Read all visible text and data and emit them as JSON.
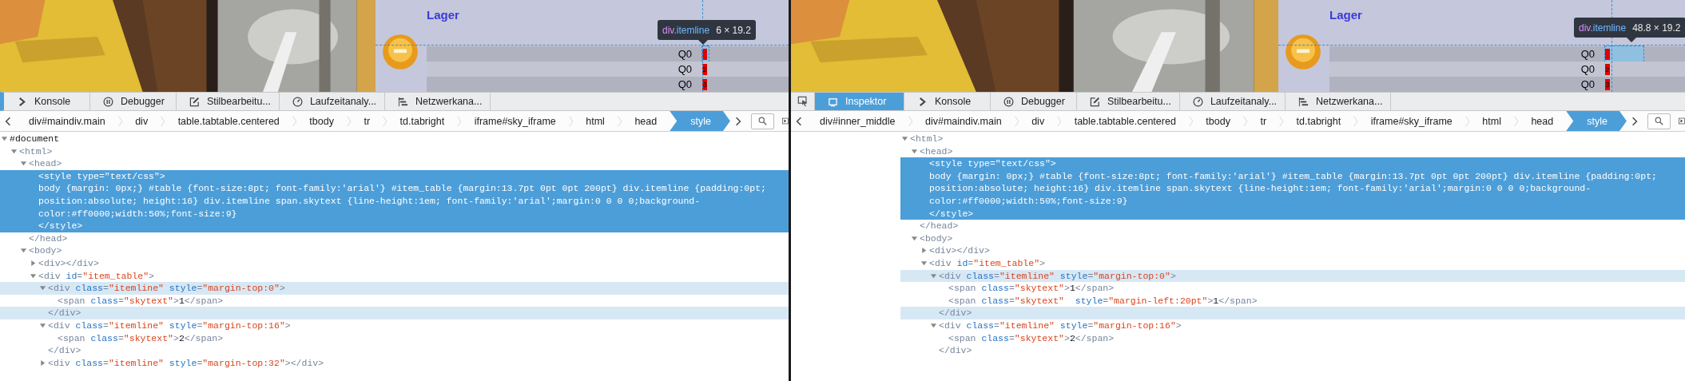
{
  "panels": [
    {
      "preview": {
        "heading": "Lager",
        "tooltip": {
          "tag": "div",
          "cls": ".itemline",
          "size": "6 × 19.2"
        },
        "rows": [
          {
            "cell": "Q0",
            "highlighted": true
          },
          {
            "cell": "Q0",
            "marker": "2",
            "highlighted": false
          },
          {
            "cell": "Q0",
            "marker": "3",
            "highlighted": false
          }
        ]
      },
      "picker": false,
      "tabs": [
        {
          "label": "Konsole",
          "kind": "console",
          "selected": false
        },
        {
          "label": "Debugger",
          "kind": "debugger",
          "selected": false
        },
        {
          "label": "Stilbearbeitu...",
          "kind": "style",
          "selected": false
        },
        {
          "label": "Laufzeitanaly...",
          "kind": "perf",
          "selected": false
        },
        {
          "label": "Netzwerkana...",
          "kind": "network",
          "selected": false
        }
      ],
      "crumbs": [
        {
          "label": "div#maindiv.main",
          "selected": false
        },
        {
          "label": "div",
          "selected": false
        },
        {
          "label": "table.tabtable.centered",
          "selected": false
        },
        {
          "label": "tbody",
          "selected": false
        },
        {
          "label": "tr",
          "selected": false
        },
        {
          "label": "td.tabright",
          "selected": false
        },
        {
          "label": "iframe#sky_iframe",
          "selected": false
        },
        {
          "label": "html",
          "selected": false
        },
        {
          "label": "head",
          "selected": false
        },
        {
          "label": "style",
          "selected": true
        }
      ],
      "nodes": [
        {
          "open": [
            {
              "kind": "text",
              "text": "#document"
            }
          ],
          "expanded": true,
          "selected": false,
          "hovered": false,
          "children": [
            {
              "open": [
                {
                  "kind": "tag",
                  "text": "<html>"
                }
              ],
              "expanded": true,
              "selected": false,
              "hovered": false,
              "children": [
                {
                  "open": [
                    {
                      "kind": "tag",
                      "text": "<head>"
                    }
                  ],
                  "close": [
                    {
                      "kind": "tag",
                      "text": "</head>"
                    }
                  ],
                  "expanded": true,
                  "selected": false,
                  "hovered": false,
                  "children": [
                    {
                      "open": [
                        {
                          "kind": "tag",
                          "text": "<style"
                        },
                        {
                          "kind": "attr",
                          "text": " type"
                        },
                        {
                          "kind": "tag",
                          "text": "="
                        },
                        {
                          "kind": "value",
                          "text": "\"text/css\""
                        },
                        {
                          "kind": "tag",
                          "text": ">"
                        }
                      ],
                      "text": "body {margin: 0px;} #table {font-size:8pt; font-family:'arial'} #item_table {margin:13.7pt 0pt 0pt 200pt} div.itemline {padding:0pt; position:absolute; height:16} div.itemline span.skytext {line-height:1em; font-family:'arial';margin:0 0 0 0;background-color:#ff0000;width:50%;font-size:9}",
                      "close": [
                        {
                          "kind": "tag",
                          "text": "</style>"
                        }
                      ],
                      "selected": true
                    }
                  ]
                },
                {
                  "open": [
                    {
                      "kind": "tag",
                      "text": "<body>"
                    }
                  ],
                  "expanded": true,
                  "selected": false,
                  "hovered": false,
                  "children": [
                    {
                      "open": [
                        {
                          "kind": "tag",
                          "text": "<div></div>"
                        }
                      ],
                      "expanded": false,
                      "selected": false,
                      "hovered": false
                    },
                    {
                      "open": [
                        {
                          "kind": "tag",
                          "text": "<div"
                        },
                        {
                          "kind": "attr",
                          "text": " id"
                        },
                        {
                          "kind": "tag",
                          "text": "="
                        },
                        {
                          "kind": "value",
                          "text": "\"item_table\""
                        },
                        {
                          "kind": "tag",
                          "text": ">"
                        }
                      ],
                      "expanded": true,
                      "selected": false,
                      "hovered": false,
                      "children": [
                        {
                          "open": [
                            {
                              "kind": "tag",
                              "text": "<div"
                            },
                            {
                              "kind": "attr",
                              "text": " class"
                            },
                            {
                              "kind": "tag",
                              "text": "="
                            },
                            {
                              "kind": "value",
                              "text": "\"itemline\""
                            },
                            {
                              "kind": "attr",
                              "text": " style"
                            },
                            {
                              "kind": "tag",
                              "text": "="
                            },
                            {
                              "kind": "value",
                              "text": "\"margin-top:0\""
                            },
                            {
                              "kind": "tag",
                              "text": ">"
                            }
                          ],
                          "close": [
                            {
                              "kind": "tag",
                              "text": "</div>"
                            }
                          ],
                          "expanded": true,
                          "selected": false,
                          "hovered": true,
                          "children": [
                            {
                              "open": [
                                {
                                  "kind": "tag",
                                  "text": "<span"
                                },
                                {
                                  "kind": "attr",
                                  "text": " class"
                                },
                                {
                                  "kind": "tag",
                                  "text": "="
                                },
                                {
                                  "kind": "value",
                                  "text": "\"skytext\""
                                },
                                {
                                  "kind": "tag",
                                  "text": ">"
                                },
                                {
                                  "kind": "text",
                                  "text": "1"
                                },
                                {
                                  "kind": "tag",
                                  "text": "</span>"
                                }
                              ],
                              "selected": false,
                              "hovered": false
                            }
                          ]
                        },
                        {
                          "open": [
                            {
                              "kind": "tag",
                              "text": "<div"
                            },
                            {
                              "kind": "attr",
                              "text": " class"
                            },
                            {
                              "kind": "tag",
                              "text": "="
                            },
                            {
                              "kind": "value",
                              "text": "\"itemline\""
                            },
                            {
                              "kind": "attr",
                              "text": " style"
                            },
                            {
                              "kind": "tag",
                              "text": "="
                            },
                            {
                              "kind": "value",
                              "text": "\"margin-top:16\""
                            },
                            {
                              "kind": "tag",
                              "text": ">"
                            }
                          ],
                          "close": [
                            {
                              "kind": "tag",
                              "text": "</div>"
                            }
                          ],
                          "expanded": true,
                          "selected": false,
                          "hovered": false,
                          "children": [
                            {
                              "open": [
                                {
                                  "kind": "tag",
                                  "text": "<span"
                                },
                                {
                                  "kind": "attr",
                                  "text": " class"
                                },
                                {
                                  "kind": "tag",
                                  "text": "="
                                },
                                {
                                  "kind": "value",
                                  "text": "\"skytext\""
                                },
                                {
                                  "kind": "tag",
                                  "text": ">"
                                },
                                {
                                  "kind": "text",
                                  "text": "2"
                                },
                                {
                                  "kind": "tag",
                                  "text": "</span>"
                                }
                              ],
                              "selected": false,
                              "hovered": false
                            }
                          ]
                        },
                        {
                          "open": [
                            {
                              "kind": "tag",
                              "text": "<div"
                            },
                            {
                              "kind": "attr",
                              "text": " class"
                            },
                            {
                              "kind": "tag",
                              "text": "="
                            },
                            {
                              "kind": "value",
                              "text": "\"itemline\""
                            },
                            {
                              "kind": "attr",
                              "text": " style"
                            },
                            {
                              "kind": "tag",
                              "text": "="
                            },
                            {
                              "kind": "value",
                              "text": "\"margin-top:32\""
                            },
                            {
                              "kind": "tag",
                              "text": "></div>"
                            }
                          ],
                          "expanded": false,
                          "selected": false,
                          "hovered": false
                        }
                      ]
                    }
                  ]
                }
              ]
            }
          ]
        }
      ]
    },
    {
      "preview": {
        "heading": "Lager",
        "tooltip": {
          "tag": "div",
          "cls": ".itemline",
          "size": "48.8 × 19.2"
        },
        "rows": [
          {
            "cell": "Q0",
            "highlighted": true
          },
          {
            "cell": "Q0",
            "marker": "2",
            "highlighted": false
          },
          {
            "cell": "Q0",
            "marker": "3",
            "highlighted": false
          }
        ]
      },
      "picker": true,
      "tabs": [
        {
          "label": "Inspektor",
          "kind": "inspector",
          "selected": true
        },
        {
          "label": "Konsole",
          "kind": "console",
          "selected": false
        },
        {
          "label": "Debugger",
          "kind": "debugger",
          "selected": false
        },
        {
          "label": "Stilbearbeitu...",
          "kind": "style",
          "selected": false
        },
        {
          "label": "Laufzeitanaly...",
          "kind": "perf",
          "selected": false
        },
        {
          "label": "Netzwerkana...",
          "kind": "network",
          "selected": false
        }
      ],
      "crumbs": [
        {
          "label": "div#inner_middle",
          "selected": false
        },
        {
          "label": "div#maindiv.main",
          "selected": false
        },
        {
          "label": "div",
          "selected": false
        },
        {
          "label": "table.tabtable.centered",
          "selected": false
        },
        {
          "label": "tbody",
          "selected": false
        },
        {
          "label": "tr",
          "selected": false
        },
        {
          "label": "td.tabright",
          "selected": false
        },
        {
          "label": "iframe#sky_iframe",
          "selected": false
        },
        {
          "label": "html",
          "selected": false
        },
        {
          "label": "head",
          "selected": false
        },
        {
          "label": "style",
          "selected": true
        }
      ],
      "nodes": [
        {
          "open": [
            {
              "kind": "tag",
              "text": "<html>"
            }
          ],
          "expanded": true,
          "selected": false,
          "hovered": false,
          "children": [
            {
              "open": [
                {
                  "kind": "tag",
                  "text": "<head>"
                }
              ],
              "close": [
                {
                  "kind": "tag",
                  "text": "</head>"
                }
              ],
              "expanded": true,
              "selected": false,
              "hovered": false,
              "children": [
                {
                  "open": [
                    {
                      "kind": "tag",
                      "text": "<style"
                    },
                    {
                      "kind": "attr",
                      "text": " type"
                    },
                    {
                      "kind": "tag",
                      "text": "="
                    },
                    {
                      "kind": "value",
                      "text": "\"text/css\""
                    },
                    {
                      "kind": "tag",
                      "text": ">"
                    }
                  ],
                  "text": "body {margin: 0px;} #table {font-size:8pt; font-family:'arial'} #item_table {margin:13.7pt 0pt 0pt 200pt} div.itemline {padding:0pt; position:absolute; height:16} div.itemline span.skytext {line-height:1em; font-family:'arial';margin:0 0 0 0;background-color:#ff0000;width:50%;font-size:9}",
                  "close": [
                    {
                      "kind": "tag",
                      "text": "</style>"
                    }
                  ],
                  "selected": true
                }
              ]
            },
            {
              "open": [
                {
                  "kind": "tag",
                  "text": "<body>"
                }
              ],
              "expanded": true,
              "selected": false,
              "hovered": false,
              "children": [
                {
                  "open": [
                    {
                      "kind": "tag",
                      "text": "<div></div>"
                    }
                  ],
                  "expanded": false,
                  "selected": false,
                  "hovered": false
                },
                {
                  "open": [
                    {
                      "kind": "tag",
                      "text": "<div"
                    },
                    {
                      "kind": "attr",
                      "text": " id"
                    },
                    {
                      "kind": "tag",
                      "text": "="
                    },
                    {
                      "kind": "value",
                      "text": "\"item_table\""
                    },
                    {
                      "kind": "tag",
                      "text": ">"
                    }
                  ],
                  "expanded": true,
                  "selected": false,
                  "hovered": false,
                  "children": [
                    {
                      "open": [
                        {
                          "kind": "tag",
                          "text": "<div"
                        },
                        {
                          "kind": "attr",
                          "text": " class"
                        },
                        {
                          "kind": "tag",
                          "text": "="
                        },
                        {
                          "kind": "value",
                          "text": "\"itemline\""
                        },
                        {
                          "kind": "attr",
                          "text": " style"
                        },
                        {
                          "kind": "tag",
                          "text": "="
                        },
                        {
                          "kind": "value",
                          "text": "\"margin-top:0\""
                        },
                        {
                          "kind": "tag",
                          "text": ">"
                        }
                      ],
                      "close": [
                        {
                          "kind": "tag",
                          "text": "</div>"
                        }
                      ],
                      "expanded": true,
                      "selected": false,
                      "hovered": true,
                      "children": [
                        {
                          "open": [
                            {
                              "kind": "tag",
                              "text": "<span"
                            },
                            {
                              "kind": "attr",
                              "text": " class"
                            },
                            {
                              "kind": "tag",
                              "text": "="
                            },
                            {
                              "kind": "value",
                              "text": "\"skytext\""
                            },
                            {
                              "kind": "tag",
                              "text": ">"
                            },
                            {
                              "kind": "text",
                              "text": "1"
                            },
                            {
                              "kind": "tag",
                              "text": "</span>"
                            }
                          ],
                          "selected": false,
                          "hovered": false
                        },
                        {
                          "open": [
                            {
                              "kind": "tag",
                              "text": "<span"
                            },
                            {
                              "kind": "attr",
                              "text": " class"
                            },
                            {
                              "kind": "tag",
                              "text": "="
                            },
                            {
                              "kind": "value",
                              "text": "\"skytext\""
                            },
                            {
                              "kind": "attr",
                              "text": "  style"
                            },
                            {
                              "kind": "tag",
                              "text": "="
                            },
                            {
                              "kind": "value",
                              "text": "\"margin-left:20pt\""
                            },
                            {
                              "kind": "tag",
                              "text": ">"
                            },
                            {
                              "kind": "text",
                              "text": "1"
                            },
                            {
                              "kind": "tag",
                              "text": "</span>"
                            }
                          ],
                          "selected": false,
                          "hovered": false
                        }
                      ]
                    },
                    {
                      "open": [
                        {
                          "kind": "tag",
                          "text": "<div"
                        },
                        {
                          "kind": "attr",
                          "text": " class"
                        },
                        {
                          "kind": "tag",
                          "text": "="
                        },
                        {
                          "kind": "value",
                          "text": "\"itemline\""
                        },
                        {
                          "kind": "attr",
                          "text": " style"
                        },
                        {
                          "kind": "tag",
                          "text": "="
                        },
                        {
                          "kind": "value",
                          "text": "\"margin-top:16\""
                        },
                        {
                          "kind": "tag",
                          "text": ">"
                        }
                      ],
                      "close": [
                        {
                          "kind": "tag",
                          "text": "</div>"
                        }
                      ],
                      "expanded": true,
                      "selected": false,
                      "hovered": false,
                      "children": [
                        {
                          "open": [
                            {
                              "kind": "tag",
                              "text": "<span"
                            },
                            {
                              "kind": "attr",
                              "text": " class"
                            },
                            {
                              "kind": "tag",
                              "text": "="
                            },
                            {
                              "kind": "value",
                              "text": "\"skytext\""
                            },
                            {
                              "kind": "tag",
                              "text": ">"
                            },
                            {
                              "kind": "text",
                              "text": "2"
                            },
                            {
                              "kind": "tag",
                              "text": "</span>"
                            }
                          ],
                          "selected": false,
                          "hovered": false
                        }
                      ]
                    }
                  ]
                }
              ]
            }
          ]
        }
      ]
    }
  ]
}
